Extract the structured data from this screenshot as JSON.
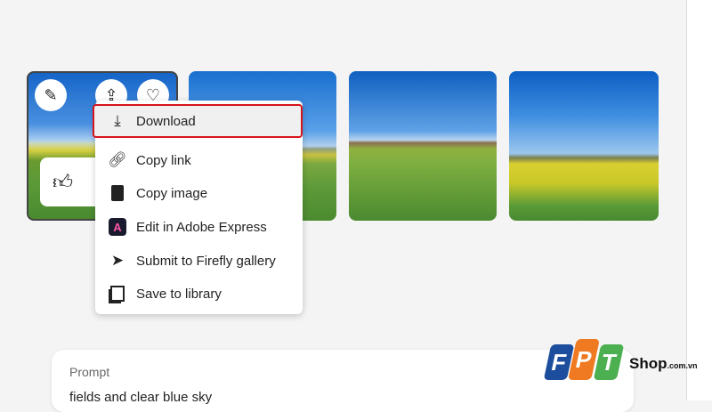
{
  "tiles": [
    {
      "name": "image-1",
      "selected": true
    },
    {
      "name": "image-2"
    },
    {
      "name": "image-3"
    },
    {
      "name": "image-4"
    }
  ],
  "tile_actions": {
    "edit": "pencil-icon",
    "share": "share-icon",
    "favorite": "heart-icon",
    "like": "thumbs-up-icon",
    "dislike": "thumbs-down-icon"
  },
  "menu": {
    "items": [
      {
        "label": "Download",
        "icon": "download-icon"
      },
      {
        "label": "Copy link",
        "icon": "link-icon"
      },
      {
        "label": "Copy image",
        "icon": "clipboard-icon"
      },
      {
        "label": "Edit in Adobe Express",
        "icon": "adobe-express-icon"
      },
      {
        "label": "Submit to Firefly gallery",
        "icon": "send-icon"
      },
      {
        "label": "Save to library",
        "icon": "library-icon"
      }
    ]
  },
  "prompt": {
    "label": "Prompt",
    "text": "fields and clear blue sky"
  },
  "watermark": {
    "letters": [
      "F",
      "P",
      "T"
    ],
    "shop": "Shop",
    "domain": ".com.vn"
  },
  "colors": {
    "highlight": "#d7141a",
    "fpt_blue": "#1d4e9e",
    "fpt_orange": "#f07a22",
    "fpt_green": "#4caf50"
  }
}
